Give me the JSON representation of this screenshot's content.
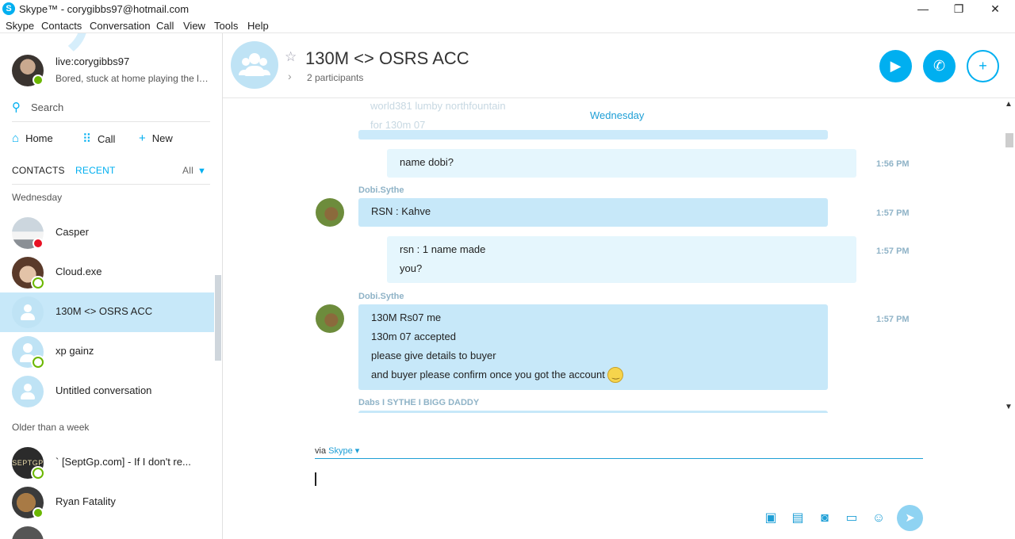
{
  "window": {
    "title": "Skype™ - corygibbs97@hotmail.com",
    "logo": "S",
    "minimize": "—",
    "restore": "❐",
    "close": "✕"
  },
  "menu": [
    "Skype",
    "Contacts",
    "Conversation",
    "Call",
    "View",
    "Tools",
    "Help"
  ],
  "profile": {
    "name": "live:corygibbs97",
    "mood": "Bored, stuck at home playing the lo..."
  },
  "search": {
    "icon": "search-icon",
    "placeholder": "Search"
  },
  "nav": {
    "home": "Home",
    "call": "Call",
    "new": "New"
  },
  "tabs": {
    "contacts": "CONTACTS",
    "recent": "RECENT",
    "filter": "All"
  },
  "sections": {
    "wednesday": "Wednesday",
    "older": "Older than a week"
  },
  "contacts": [
    {
      "name": "Casper",
      "status": "busy"
    },
    {
      "name": "Cloud.exe",
      "status": "available"
    },
    {
      "name": "130M <> OSRS ACC",
      "status": "group",
      "selected": true
    },
    {
      "name": "xp gainz",
      "status": "available"
    },
    {
      "name": "Untitled conversation",
      "status": "group"
    },
    {
      "name": "` [SeptGp.com] - If I don't re...",
      "status": "available",
      "avatar_text": "SEPTGP"
    },
    {
      "name": "Ryan Fatality",
      "status": "online"
    }
  ],
  "conversation": {
    "title": "130M <> OSRS ACC",
    "participants": "2 participants",
    "day": "Wednesday",
    "ghost_lines": [
      "world381 lumby northfountain",
      "for 130m 07"
    ],
    "messages": [
      {
        "dir": "out",
        "lines": [
          "name dobi?"
        ],
        "time": "1:56 PM"
      },
      {
        "dir": "in",
        "sender": "Dobi.Sythe",
        "lines": [
          "RSN : Kahve"
        ],
        "time": "1:57 PM"
      },
      {
        "dir": "out",
        "lines": [
          "rsn : 1 name made",
          "you?"
        ],
        "time": "1:57 PM"
      },
      {
        "dir": "in",
        "sender": "Dobi.Sythe",
        "lines": [
          "130M Rs07 me",
          "130m 07 accepted",
          "please give details to buyer",
          "and buyer please confirm once you got the account"
        ],
        "time": "1:57 PM"
      }
    ],
    "next_sender": "Dabs I SYTHE I BIGG DADDY"
  },
  "compose": {
    "via": "via",
    "via_service": "Skype ▾"
  },
  "colors": {
    "accent": "#00aff0",
    "bubble_in": "#c7e8f9",
    "bubble_out": "#e5f6fd",
    "online": "#6bb700",
    "busy": "#e81123"
  }
}
